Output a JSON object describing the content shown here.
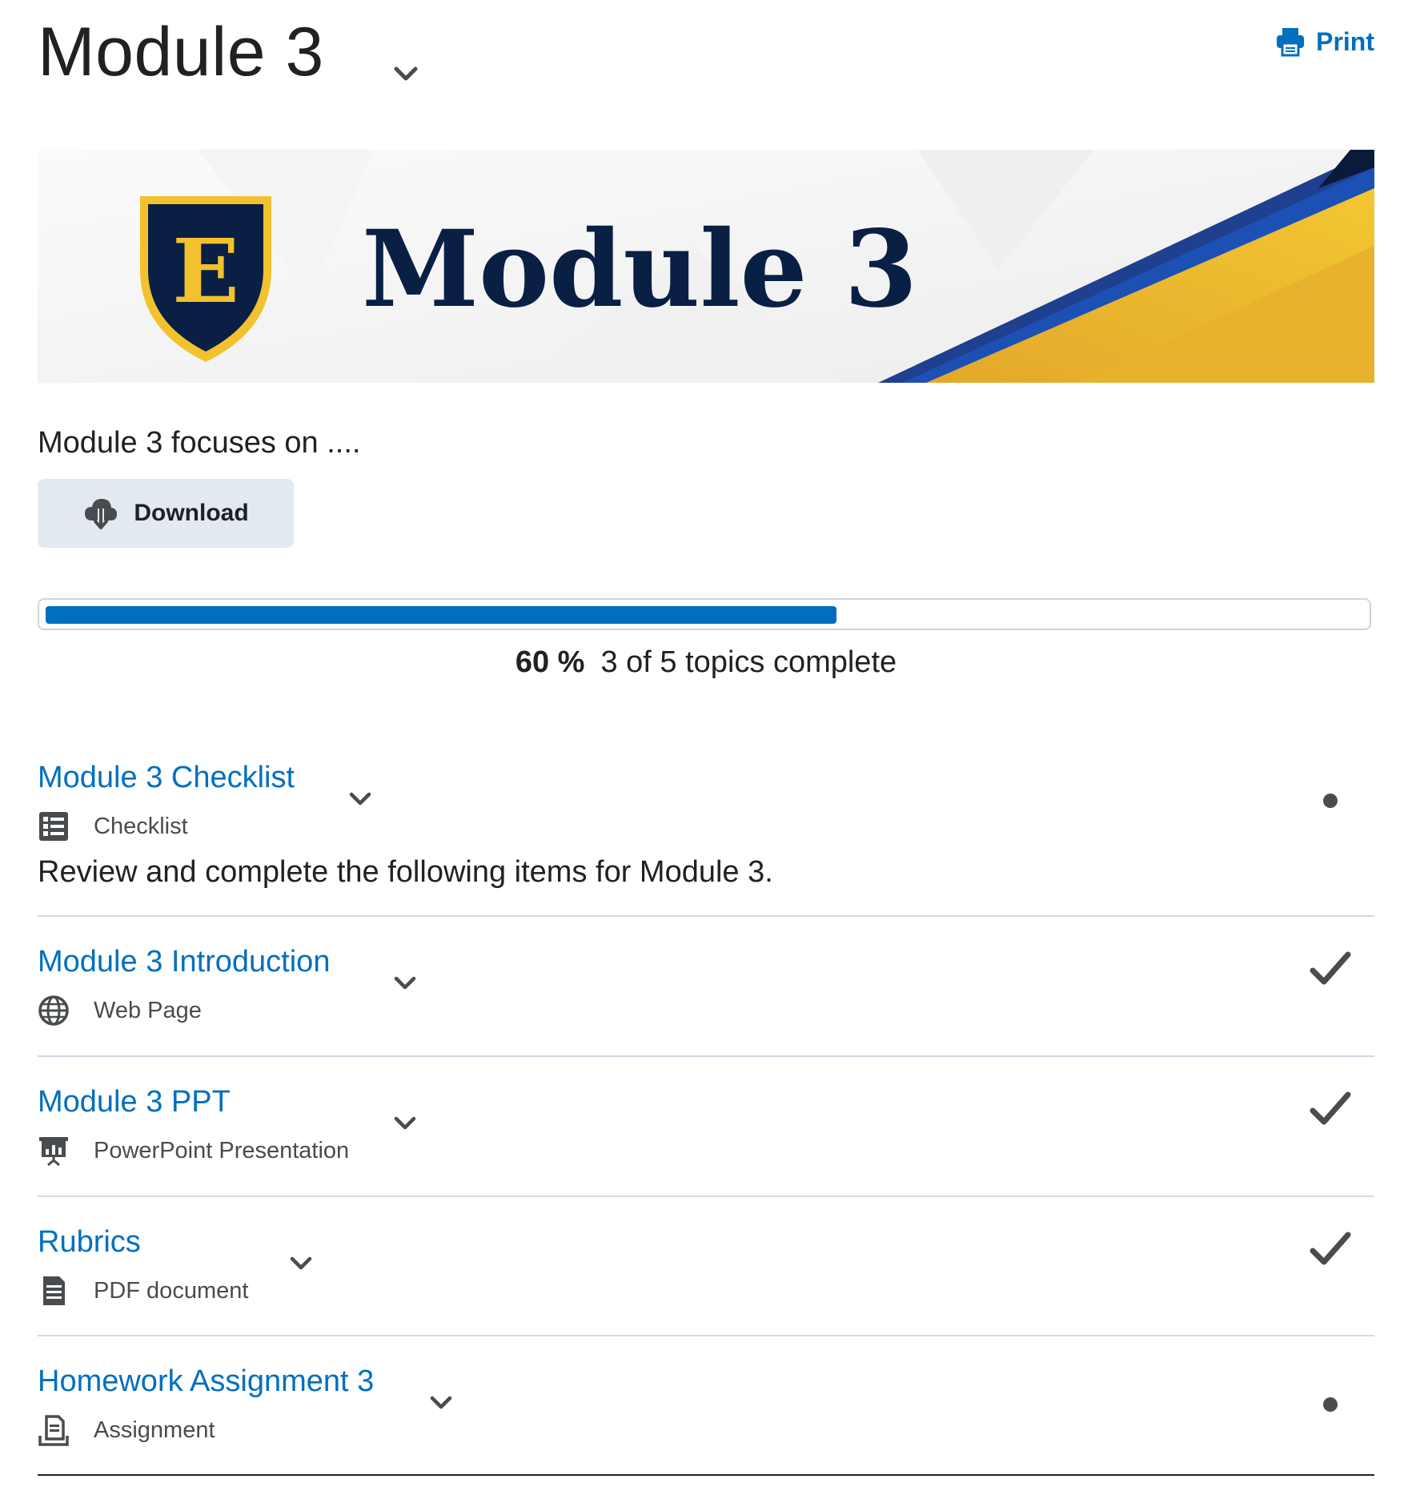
{
  "header": {
    "title": "Module 3",
    "print_label": "Print"
  },
  "banner": {
    "title": "Module 3",
    "logo_letter": "E"
  },
  "description": "Module 3 focuses on ....",
  "download": {
    "label": "Download"
  },
  "progress": {
    "percent_label": "60 %",
    "summary": "3 of 5 topics complete",
    "fraction": 0.6
  },
  "topics": [
    {
      "title": "Module 3 Checklist",
      "type": "Checklist",
      "icon": "checklist-icon",
      "description": "Review and complete the following items for Module 3.",
      "status": "incomplete"
    },
    {
      "title": "Module 3 Introduction",
      "type": "Web Page",
      "icon": "globe-icon",
      "status": "complete"
    },
    {
      "title": "Module 3 PPT",
      "type": "PowerPoint Presentation",
      "icon": "presentation-icon",
      "status": "complete"
    },
    {
      "title": "Rubrics",
      "type": "PDF document",
      "icon": "document-icon",
      "status": "complete"
    },
    {
      "title": "Homework Assignment 3",
      "type": "Assignment",
      "icon": "assignment-icon",
      "status": "incomplete"
    }
  ],
  "colors": {
    "link": "#006fbf",
    "progress": "#006fbf",
    "button_bg": "#e3e9f1",
    "navy": "#0a1f44",
    "gold": "#f0be2e"
  }
}
